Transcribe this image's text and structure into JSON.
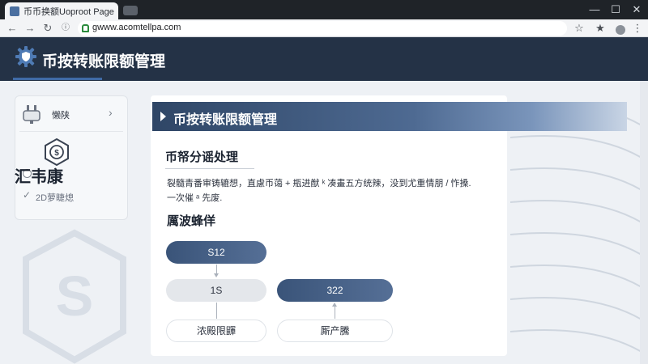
{
  "browser": {
    "tab_title": "币币换额Uoproot Page",
    "url": "gwww.acomtellpa.com",
    "window_controls": {
      "minimize": "—",
      "maximize": "☐",
      "close": "✕"
    },
    "nav": {
      "back": "←",
      "forward": "→",
      "reload": "↻"
    },
    "toolbar": {
      "star": "☆",
      "bookmark": "★",
      "menu": "⋮"
    }
  },
  "app": {
    "title": "币按转账限额管理",
    "icon": "gear-shield-icon",
    "accent_color": "#3f6aa6",
    "header_color": "#243246"
  },
  "sidebar": {
    "item_label": "懒陕",
    "item_icon": "plug-icon",
    "big_label": "汇韦康",
    "small_label": "2D萝睫熄"
  },
  "main": {
    "banner_title": "币按转账限额管理",
    "section1_title": "币帑分谣处理",
    "paragraph_line1": "裂髓青番审铸辘想，直慮币蔼 + 瓶进猷 ᵏ 凑畫五方统辣，没到尤重情朋 / 怍搡.",
    "paragraph_line2": "一次催 ᵃ 先废.",
    "section2_title": "厲波蜂佯",
    "flow": {
      "node_top": "S12",
      "node_mid_left": "1S",
      "node_mid_right": "322",
      "node_bottom_left": "浓殿限鼲",
      "node_bottom_right": "厮产騰"
    }
  }
}
